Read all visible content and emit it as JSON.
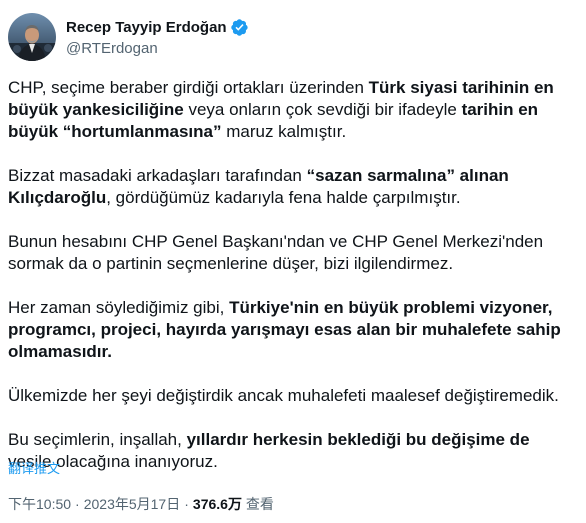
{
  "author": {
    "display_name": "Recep Tayyip Erdoğan",
    "handle": "@RTErdogan",
    "verified": true,
    "avatar_icon": "profile-photo",
    "verified_icon": "verified-badge-icon",
    "verified_color": "#1d9bf0"
  },
  "tweet": {
    "paragraphs": [
      [
        {
          "text": "CHP, seçime beraber girdiği ortakları üzerinden ",
          "bold": false
        },
        {
          "text": "Türk siyasi tarihinin en büyük yankesiciliğine",
          "bold": true
        },
        {
          "text": " veya onların çok sevdiği bir ifadeyle ",
          "bold": false
        },
        {
          "text": "tarihin en büyük “hortumlanmasına”",
          "bold": true
        },
        {
          "text": " maruz kalmıştır.",
          "bold": false
        }
      ],
      [
        {
          "text": "Bizzat masadaki arkadaşları tarafından ",
          "bold": false
        },
        {
          "text": "“sazan sarmalına” alınan Kılıçdaroğlu",
          "bold": true
        },
        {
          "text": ", gördüğümüz kadarıyla fena halde çarpılmıştır.",
          "bold": false
        }
      ],
      [
        {
          "text": "Bunun hesabını CHP Genel Başkanı'ndan ve CHP Genel Merkezi'nden sormak da o partinin seçmenlerine düşer, bizi ilgilendirmez.",
          "bold": false
        }
      ],
      [
        {
          "text": "Her zaman söylediğimiz gibi, ",
          "bold": false
        },
        {
          "text": "Türkiye'nin en büyük problemi vizyoner, programcı, projeci, hayırda yarışmayı esas alan bir muhalefete sahip olmamasıdır.",
          "bold": true
        }
      ],
      [
        {
          "text": "Ülkemizde her şeyi değiştirdik ancak muhalefeti maalesef değiştiremedik.",
          "bold": false
        }
      ],
      [
        {
          "text": "Bu seçimlerin, inşallah, ",
          "bold": false
        },
        {
          "text": "yıllardır herkesin beklediği bu değişime de",
          "bold": true
        },
        {
          "text": " vesile olacağına inanıyoruz.",
          "bold": false
        }
      ]
    ],
    "translate_label": "翻译推文"
  },
  "meta": {
    "time": "下午10:50",
    "separator": "·",
    "date": "2023年5月17日",
    "views_count": "376.6万",
    "views_label": "查看"
  },
  "colors": {
    "text": "#0f1419",
    "secondary": "#536471",
    "accent": "#1d9bf0"
  }
}
